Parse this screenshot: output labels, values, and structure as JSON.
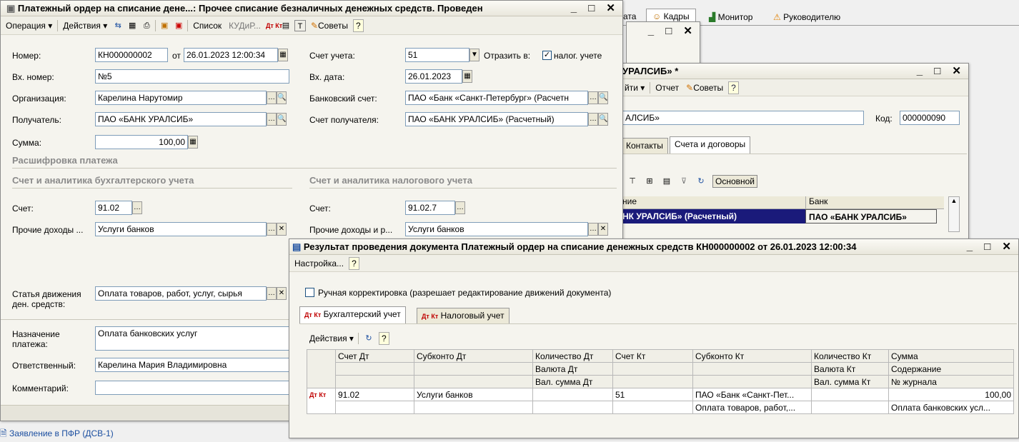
{
  "bg": {
    "tabs": [
      "ата",
      "Кадры",
      "Монитор",
      "Руководителю"
    ],
    "bottom_link": "Заявление в ПФР (ДСВ-1)"
  },
  "counterparty": {
    "title": "УРАЛСИБ» *",
    "toolbar": [
      "йти ▾",
      "Отчет",
      "Советы",
      "?"
    ],
    "name_value": "АЛСИБ»",
    "code_label": "Код:",
    "code_value": "000000090",
    "tabs": [
      "Контакты",
      "Счета и договоры"
    ],
    "main_btn": "Основной",
    "grid_head": [
      "ние",
      "Банк"
    ],
    "grid_row": [
      "НК УРАЛСИБ» (Расчетный)",
      "ПАО «БАНК УРАЛСИБ»"
    ]
  },
  "payment": {
    "title": "Платежный ордер на списание дене...: Прочее списание безналичных денежных средств. Проведен",
    "toolbar": {
      "operation": "Операция ▾",
      "actions": "Действия ▾",
      "list": "Список",
      "kudir": "КУДиР...",
      "tips": "Советы",
      "help": "?"
    },
    "number_label": "Номер:",
    "number": "КН000000002",
    "from_label": "от",
    "date": "26.01.2023 12:00:34",
    "account_label": "Счет учета:",
    "account": "51",
    "reflect_label": "Отразить в:",
    "tax_label": "налог. учете",
    "in_number_label": "Вх. номер:",
    "in_number": "№5",
    "in_date_label": "Вх. дата:",
    "in_date": "26.01.2023",
    "org_label": "Организация:",
    "org": "Карелина Нарутомир",
    "bank_acc_label": "Банковский счет:",
    "bank_acc": "ПАО «Банк «Санкт-Петербург» (Расчетн",
    "recipient_label": "Получатель:",
    "recipient": "ПАО «БАНК УРАЛСИБ»",
    "rec_acc_label": "Счет получателя:",
    "rec_acc": "ПАО «БАНК УРАЛСИБ» (Расчетный)",
    "sum_label": "Сумма:",
    "sum": "100,00",
    "decode_title": "Расшифровка платежа",
    "acc_section": "Счет и аналитика бухгалтерского учета",
    "tax_section": "Счет и аналитика налогового учета",
    "acc_label": "Счет:",
    "acc_value": "91.02",
    "tax_acc_label": "Счет:",
    "tax_acc_value": "91.02.7",
    "other_income_label": "Прочие доходы ...",
    "other_income": "Услуги банков",
    "other_income2_label": "Прочие доходы и р...",
    "other_income2": "Услуги банков",
    "cashflow_label1": "Статья движения",
    "cashflow_label2": "ден. средств:",
    "cashflow": "Оплата товаров, работ, услуг, сырья",
    "purpose_label1": "Назначение",
    "purpose_label2": "платежа:",
    "purpose": "Оплата банковских услуг",
    "resp_label": "Ответственный:",
    "resp": "Карелина Мария Владимировна",
    "comment_label": "Комментарий:",
    "comment": ""
  },
  "result": {
    "title": "Результат проведения документа Платежный ордер на списание денежных средств КН000000002 от 26.01.2023 12:00:34",
    "settings": "Настройка...",
    "help": "?",
    "manual_check": "Ручная корректировка (разрешает редактирование движений документа)",
    "tab_acc": "Бухгалтерский учет",
    "tab_tax": "Налоговый учет",
    "actions": "Действия ▾",
    "headers": {
      "r1": [
        "Счет Дт",
        "Субконто Дт",
        "Количество Дт",
        "Счет Кт",
        "Субконто Кт",
        "Количество Кт",
        "Сумма"
      ],
      "r2": [
        "Валюта Дт",
        "Валюта Кт",
        "Содержание"
      ],
      "r3": [
        "Вал. сумма Дт",
        "Вал. сумма Кт",
        "№ журнала"
      ]
    },
    "row": {
      "dt_acc": "91.02",
      "dt_sub": "Услуги банков",
      "kt_acc": "51",
      "kt_sub1": "ПАО «Банк «Санкт-Пет...",
      "kt_sub2": "Оплата товаров, работ,...",
      "sum": "100,00",
      "content": "Оплата банковских усл..."
    }
  }
}
